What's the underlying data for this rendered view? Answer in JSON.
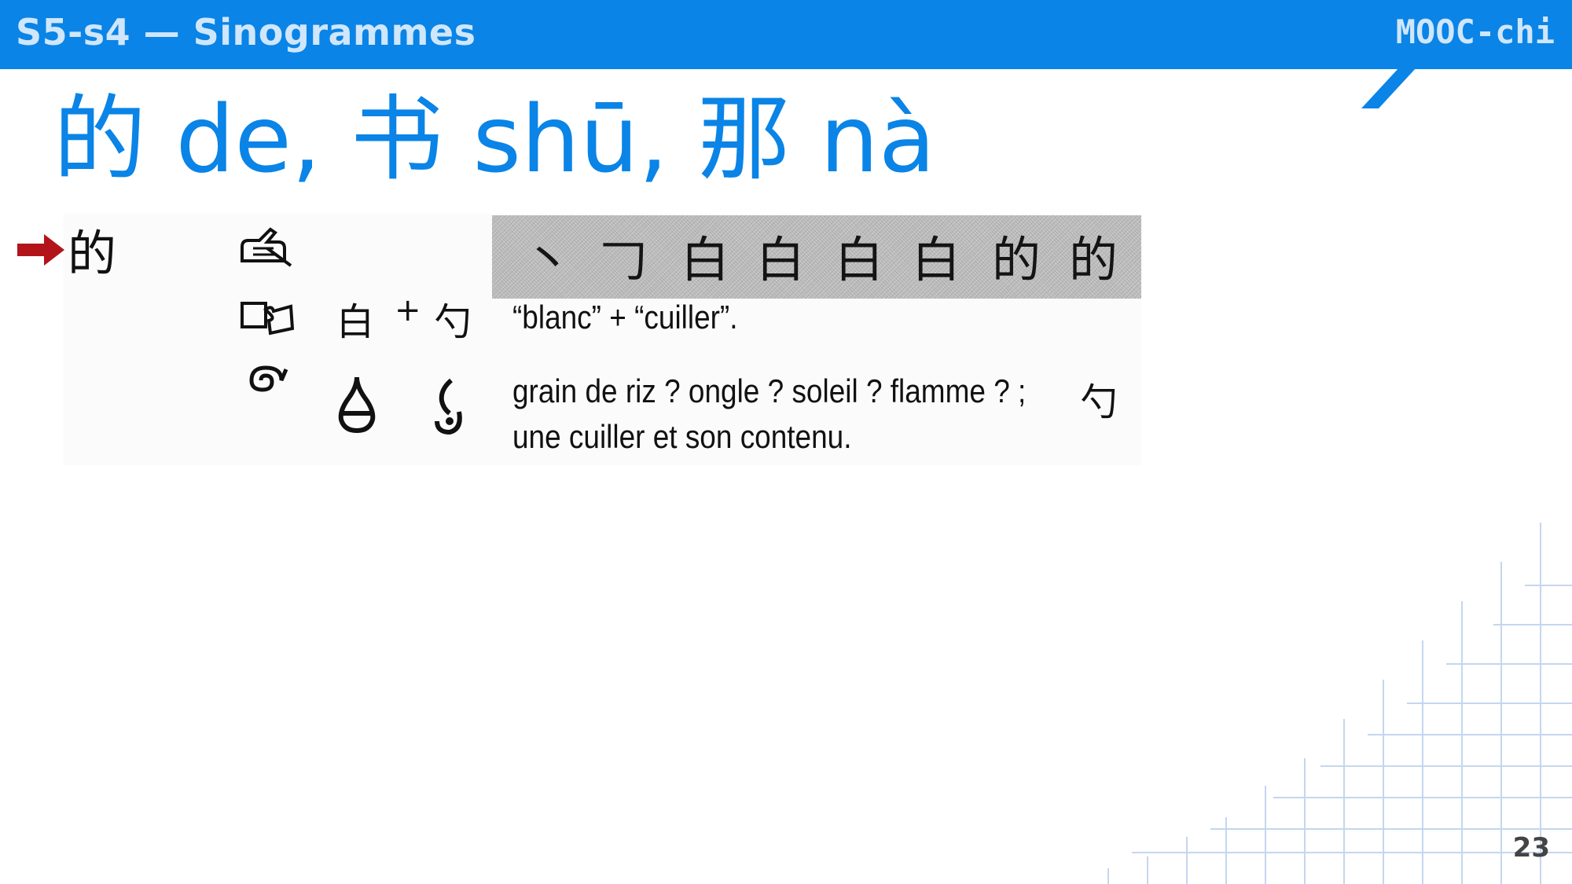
{
  "header": {
    "title": "S5-s4 — Sinogrammes",
    "brand": "MOOC-chi",
    "color": "#0a84e6"
  },
  "slide": {
    "title": "的 de, 书 shū, 那 nà",
    "page_number": "23"
  },
  "entry": {
    "character": "的",
    "arrow_icon": "red-right-arrow",
    "stroke_order": [
      "丶",
      "𠃌",
      "白",
      "白",
      "白",
      "白",
      "的",
      "的"
    ],
    "composition": {
      "component1": "白",
      "plus": "+",
      "component2": "勺",
      "meaning": "“blanc” + “cuiller”."
    },
    "etymology": {
      "line1": "grain de riz ? ongle ? soleil ? flamme ? ;",
      "char": "勺",
      "line2": "une cuiller et son contenu."
    }
  }
}
